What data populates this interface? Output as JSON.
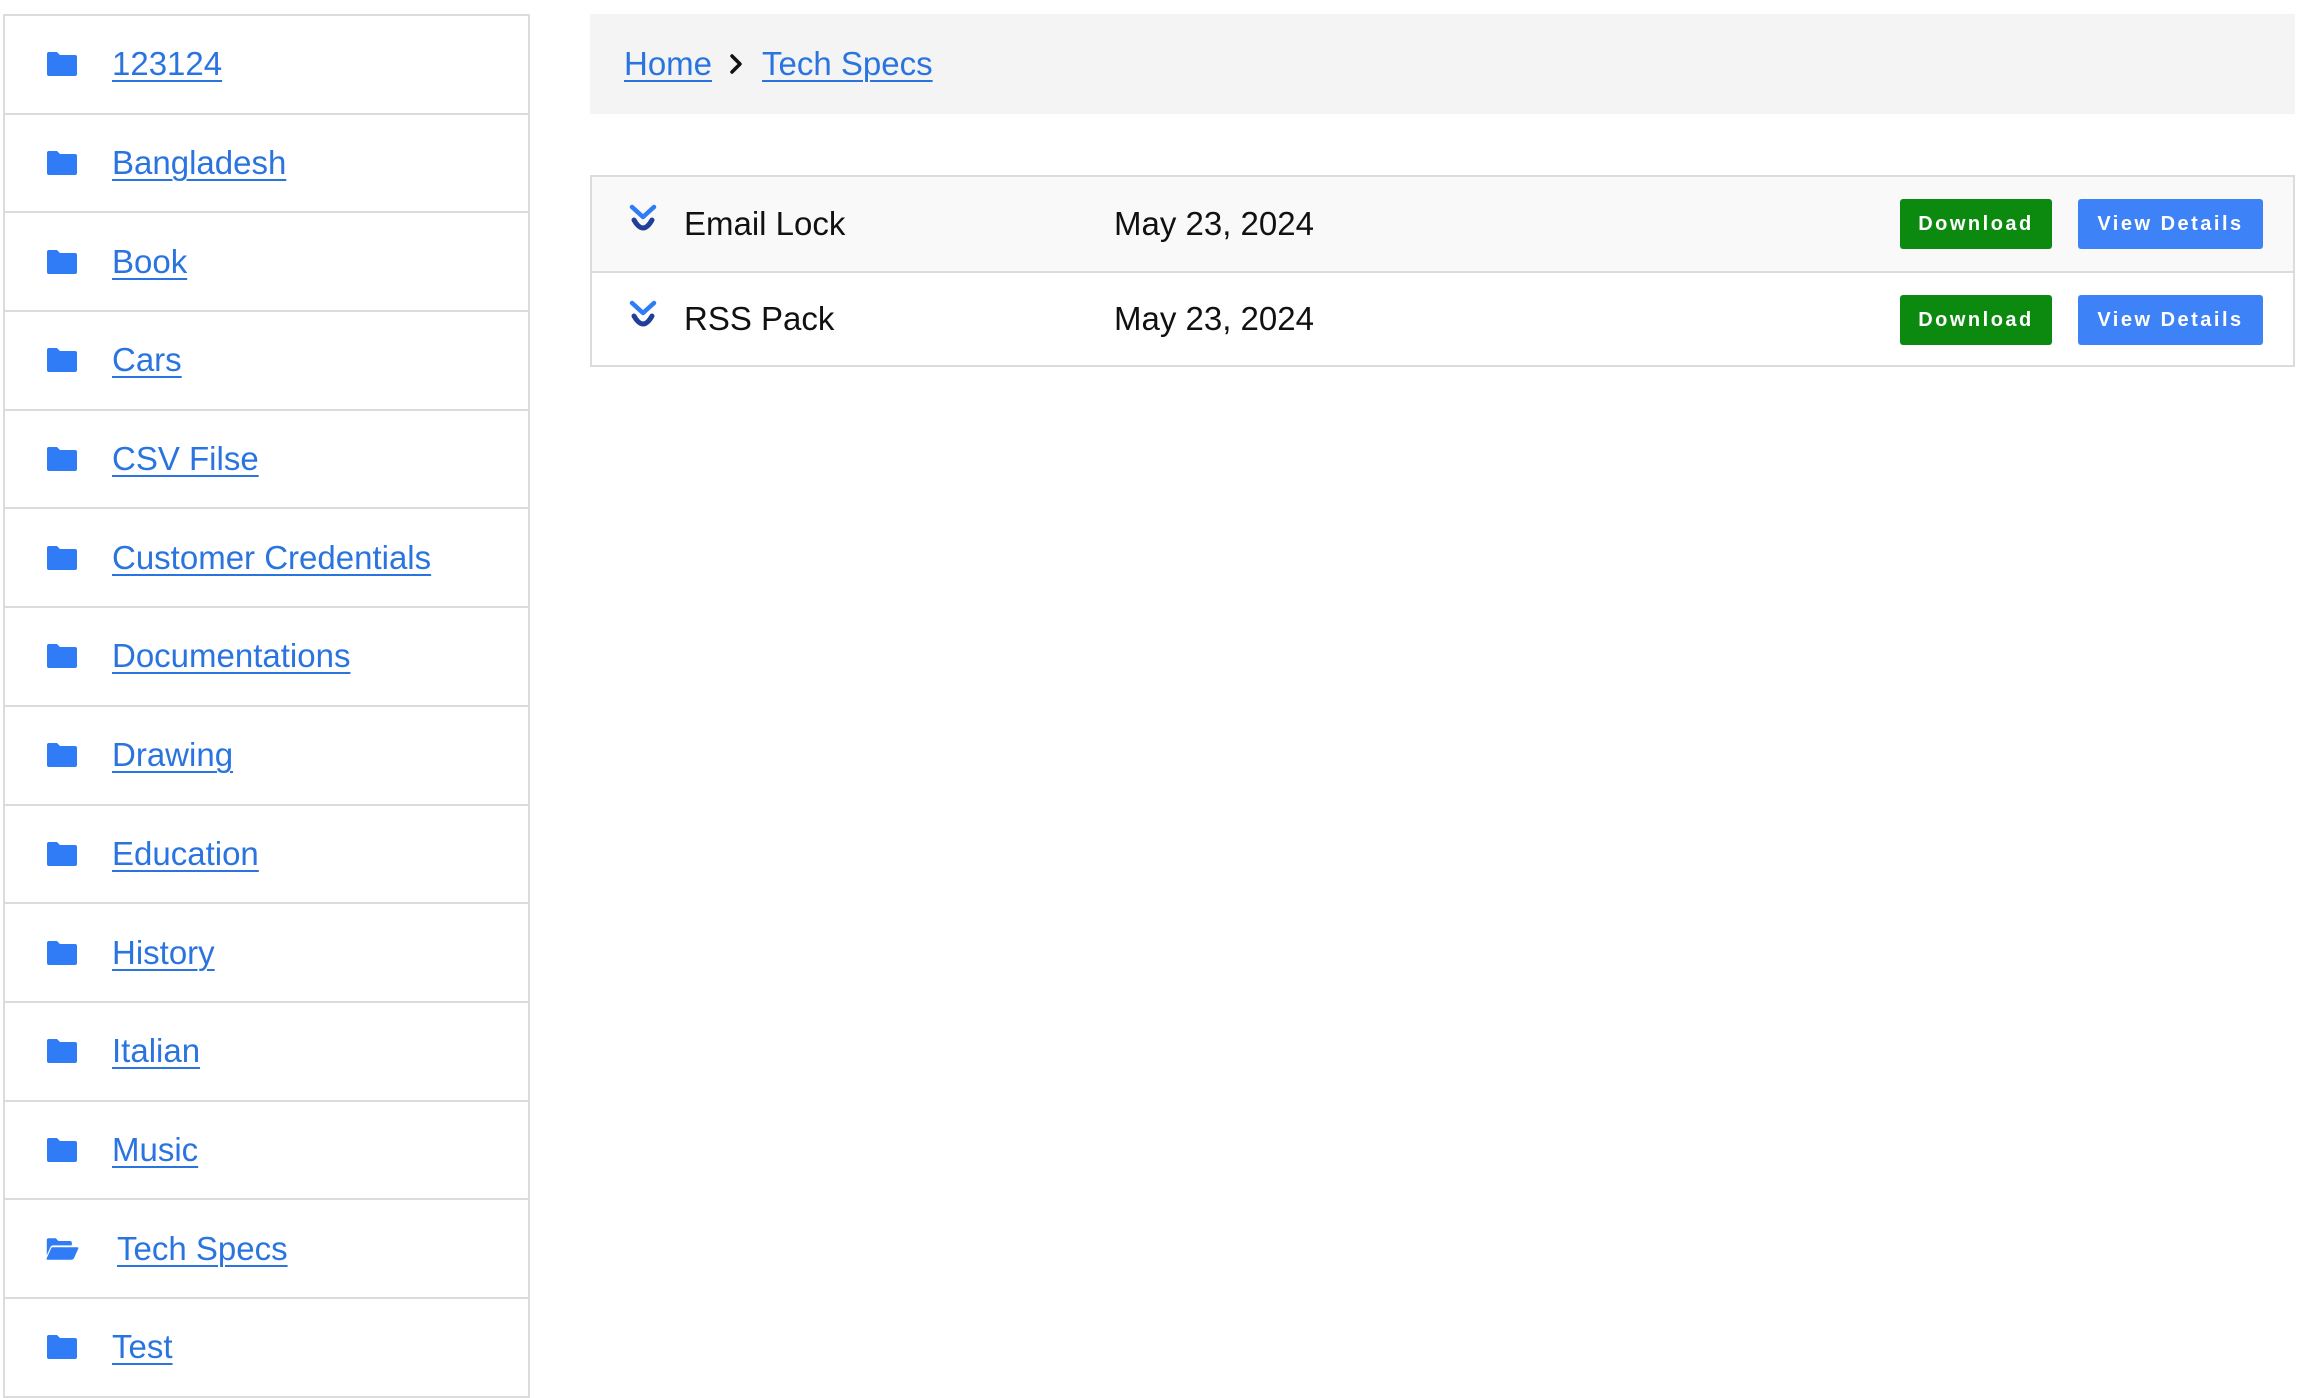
{
  "sidebar": {
    "items": [
      {
        "label": "123124",
        "icon": "folder-icon"
      },
      {
        "label": "Bangladesh",
        "icon": "folder-icon"
      },
      {
        "label": "Book",
        "icon": "folder-icon"
      },
      {
        "label": "Cars",
        "icon": "folder-icon"
      },
      {
        "label": "CSV Filse",
        "icon": "folder-icon"
      },
      {
        "label": "Customer Credentials",
        "icon": "folder-icon"
      },
      {
        "label": "Documentations",
        "icon": "folder-icon"
      },
      {
        "label": "Drawing",
        "icon": "folder-icon"
      },
      {
        "label": "Education",
        "icon": "folder-icon"
      },
      {
        "label": "History",
        "icon": "folder-icon"
      },
      {
        "label": "Italian",
        "icon": "folder-icon"
      },
      {
        "label": "Music",
        "icon": "folder-icon"
      },
      {
        "label": "Tech Specs",
        "icon": "folder-open-icon",
        "active": true
      },
      {
        "label": "Test",
        "icon": "folder-icon"
      }
    ]
  },
  "breadcrumb": {
    "items": [
      "Home",
      "Tech Specs"
    ],
    "separator_icon": "chevron-right-icon"
  },
  "files": {
    "rows": [
      {
        "name": "Email Lock",
        "date": "May 23, 2024",
        "download_label": "Download",
        "details_label": "View Details",
        "expand_icon": "chevron-double-down-icon"
      },
      {
        "name": "RSS Pack",
        "date": "May 23, 2024",
        "download_label": "Download",
        "details_label": "View Details",
        "expand_icon": "chevron-double-down-icon"
      }
    ]
  },
  "colors": {
    "link": "#2a74e0",
    "folder_icon": "#2f7cf6",
    "download_button": "#0c8a10",
    "details_button": "#3d82f6",
    "expand_icon": "#1f3f9a",
    "border": "#dcdcdc",
    "breadcrumb_background": "#f4f4f4"
  }
}
